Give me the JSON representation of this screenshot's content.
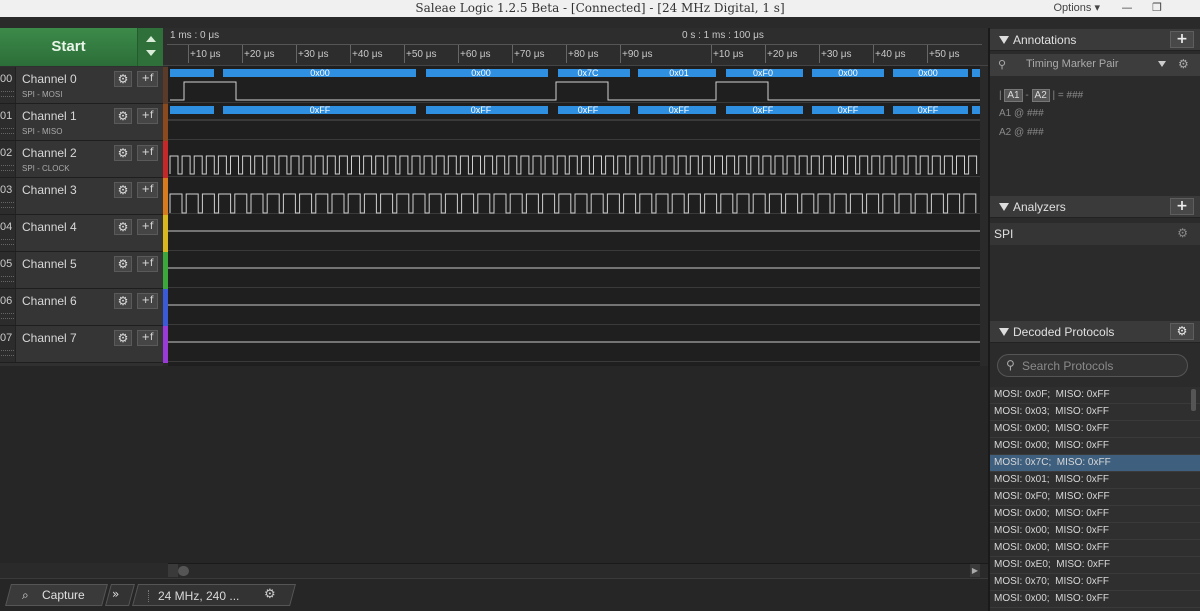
{
  "window": {
    "title": "Saleae Logic 1.2.5 Beta - [Connected] - [24 MHz Digital, 1 s]",
    "options_label": "Options ▾",
    "minimize_icon": "minimize-icon",
    "restore_icon": "restore-icon"
  },
  "start_button": {
    "label": "Start"
  },
  "timeline": {
    "left_marker": "1 ms : 0 μs",
    "center_marker": "0 s : 1 ms : 100 μs",
    "ticks": [
      "+10 μs",
      "+20 μs",
      "+30 μs",
      "+40 μs",
      "+50 μs",
      "+60 μs",
      "+70 μs",
      "+80 μs",
      "+90 μs",
      "+10 μs",
      "+20 μs",
      "+30 μs",
      "+40 μs",
      "+50 μs"
    ]
  },
  "channels": [
    {
      "num": "00",
      "name": "Channel 0",
      "sub": "SPI - MOSI",
      "color": "#5a3a28"
    },
    {
      "num": "01",
      "name": "Channel 1",
      "sub": "SPI - MISO",
      "color": "#8b4a1e"
    },
    {
      "num": "02",
      "name": "Channel 2",
      "sub": "SPI - CLOCK",
      "color": "#c42828"
    },
    {
      "num": "03",
      "name": "Channel 3",
      "sub": "",
      "color": "#d87a1e"
    },
    {
      "num": "04",
      "name": "Channel 4",
      "sub": "",
      "color": "#d8b81e"
    },
    {
      "num": "05",
      "name": "Channel 5",
      "sub": "",
      "color": "#3ca83c"
    },
    {
      "num": "06",
      "name": "Channel 6",
      "sub": "",
      "color": "#3a5ad8"
    },
    {
      "num": "07",
      "name": "Channel 7",
      "sub": "",
      "color": "#9a3ad8"
    }
  ],
  "decoded": {
    "mosi": [
      "0x00",
      "0x00",
      "0x7C",
      "0x01",
      "0xF0",
      "0x00",
      "0x00"
    ],
    "miso": [
      "0xFF",
      "0xFF",
      "0xFF",
      "0xFF",
      "0xFF",
      "0xFF",
      "0xFF"
    ]
  },
  "bottom": {
    "capture_label": "Capture",
    "settings_label": "24 MHz, 240 ..."
  },
  "annotations": {
    "header": "Annotations",
    "marker_select": "Timing Marker Pair",
    "formula_a1": "A1",
    "formula_dash": "-",
    "formula_a2": "A2",
    "formula_rest": "| = ###",
    "a1_label": "A1  @  ###",
    "a2_label": "A2  @  ###"
  },
  "analyzers": {
    "header": "Analyzers",
    "items": [
      "SPI"
    ]
  },
  "decoded_protocols": {
    "header": "Decoded Protocols",
    "search_placeholder": "Search Protocols",
    "rows": [
      "MOSI: 0x0F;  MISO: 0xFF",
      "MOSI: 0x03;  MISO: 0xFF",
      "MOSI: 0x00;  MISO: 0xFF",
      "MOSI: 0x00;  MISO: 0xFF",
      "MOSI: 0x7C;  MISO: 0xFF",
      "MOSI: 0x01;  MISO: 0xFF",
      "MOSI: 0xF0;  MISO: 0xFF",
      "MOSI: 0x00;  MISO: 0xFF",
      "MOSI: 0x00;  MISO: 0xFF",
      "MOSI: 0x00;  MISO: 0xFF",
      "MOSI: 0xE0;  MISO: 0xFF",
      "MOSI: 0x70;  MISO: 0xFF",
      "MOSI: 0x00;  MISO: 0xFF"
    ],
    "selected_row": "MOSI: 0x7C;  MISO: 0xFF"
  },
  "colors": {
    "start_green": "#2f7a3d",
    "decode_blue": "#2f8fe0",
    "selected_row": "#3e5f7e"
  }
}
